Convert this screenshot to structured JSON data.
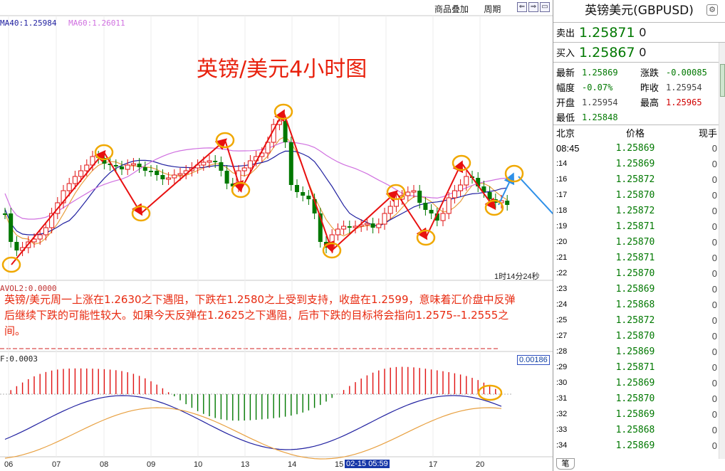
{
  "header": {
    "links": [
      "商品叠加",
      "周期"
    ],
    "window_controls": [
      "⇐",
      "⇒",
      "▭"
    ]
  },
  "ma_legend": {
    "ma40": "MA40:1.25984",
    "ma60": "MA60:1.26011"
  },
  "chart_title": "英镑/美元4小时图",
  "timer": "1时14分24秒",
  "vol_label": "AVOL2:0.0000",
  "commentary": "英镑/美元周一上涨在1.2630之下遇阻，下跌在1.2580之上受到支持，收盘在1.2599，意味着汇价盘中反弹后继续下跌的可能性较大。如果今天反弹在1.2625之下遇阻，后市下跌的目标将会指向1.2575--1.2555之间。",
  "macd_label": "F:0.0003",
  "macd_value": "0.00186",
  "x_axis": {
    "labels": [
      "06",
      "07",
      "08",
      "09",
      "10",
      "13",
      "14",
      "15",
      "17",
      "20"
    ],
    "cursor_time": "02-15 05:59"
  },
  "colors": {
    "up": "#e01010",
    "down": "#007800",
    "ma_short": "#e8a040",
    "ma_mid": "#2020a0",
    "ma_long": "#d070e0",
    "annotation_red": "#e81010",
    "annotation_blue": "#2e90e8",
    "highlight_circle": "#f0a800"
  },
  "icons": {
    "settings": "gear-icon",
    "panel_tab": "笔"
  },
  "quote": {
    "title": "英镑美元(GBPUSD)",
    "sell_label": "卖出",
    "sell_value": "1.25871",
    "sell_qty": "0",
    "buy_label": "买入",
    "buy_value": "1.25867",
    "buy_qty": "0",
    "stats": [
      [
        {
          "k": "最新",
          "v": "1.25869",
          "c": "green"
        },
        {
          "k": "涨跌",
          "v": "-0.00085",
          "c": "green"
        }
      ],
      [
        {
          "k": "幅度",
          "v": "-0.07%",
          "c": "green"
        },
        {
          "k": "昨收",
          "v": "1.25954",
          "c": "gray"
        }
      ],
      [
        {
          "k": "开盘",
          "v": "1.25954",
          "c": "gray"
        },
        {
          "k": "最高",
          "v": "1.25965",
          "c": "red"
        }
      ],
      [
        {
          "k": "最低",
          "v": "1.25848",
          "c": "green"
        },
        {
          "k": "",
          "v": "",
          "c": "gray"
        }
      ]
    ],
    "ticks_header": [
      "北京",
      "价格",
      "现手"
    ],
    "ticks": [
      {
        "t": "08:45",
        "p": "1.25869",
        "n": "0"
      },
      {
        "t": ":14",
        "p": "1.25869",
        "n": "0"
      },
      {
        "t": ":16",
        "p": "1.25872",
        "n": "0"
      },
      {
        "t": ":17",
        "p": "1.25870",
        "n": "0"
      },
      {
        "t": ":18",
        "p": "1.25872",
        "n": "0"
      },
      {
        "t": ":19",
        "p": "1.25871",
        "n": "0"
      },
      {
        "t": ":20",
        "p": "1.25870",
        "n": "0"
      },
      {
        "t": ":21",
        "p": "1.25871",
        "n": "0"
      },
      {
        "t": ":22",
        "p": "1.25870",
        "n": "0"
      },
      {
        "t": ":23",
        "p": "1.25869",
        "n": "0"
      },
      {
        "t": ":24",
        "p": "1.25868",
        "n": "0"
      },
      {
        "t": ":25",
        "p": "1.25872",
        "n": "0"
      },
      {
        "t": ":27",
        "p": "1.25870",
        "n": "0"
      },
      {
        "t": ":28",
        "p": "1.25869",
        "n": "0"
      },
      {
        "t": ":29",
        "p": "1.25871",
        "n": "0"
      },
      {
        "t": ":30",
        "p": "1.25869",
        "n": "0"
      },
      {
        "t": ":31",
        "p": "1.25870",
        "n": "0"
      },
      {
        "t": ":32",
        "p": "1.25869",
        "n": "0"
      },
      {
        "t": ":33",
        "p": "1.25868",
        "n": "0"
      },
      {
        "t": ":34",
        "p": "1.25869",
        "n": "0"
      }
    ]
  }
}
